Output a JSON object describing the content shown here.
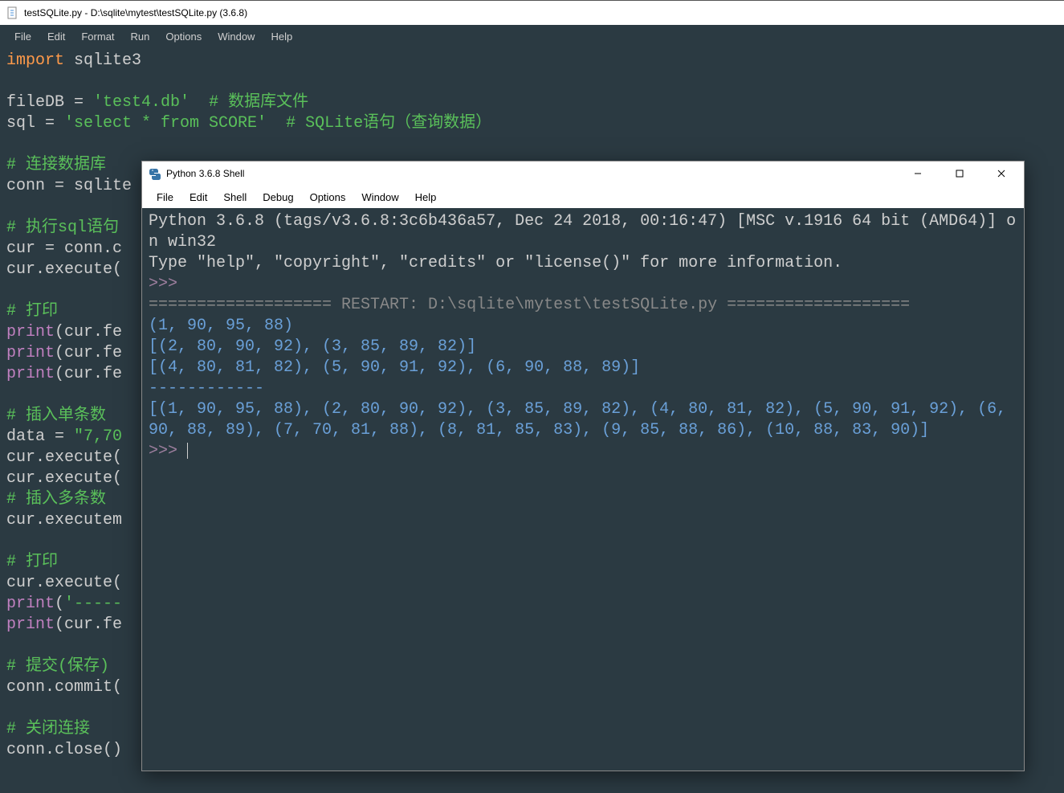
{
  "editor": {
    "title": "testSQLite.py - D:\\sqlite\\mytest\\testSQLite.py (3.6.8)",
    "menus": [
      "File",
      "Edit",
      "Format",
      "Run",
      "Options",
      "Window",
      "Help"
    ],
    "code": {
      "l1_import": "import",
      "l1_mod": " sqlite3",
      "blank": "",
      "l3a": "fileDB = ",
      "l3b": "'test4.db'",
      "l3c": "  # 数据库文件",
      "l4a": "sql = ",
      "l4b": "'select * from SCORE'",
      "l4c": "  # SQLite语句（查询数据）",
      "l6": "# 连接数据库",
      "l7": "conn = sqlite",
      "l9": "# 执行sql语句",
      "l10": "cur = conn.c",
      "l11": "cur.execute(",
      "l13": "# 打印",
      "l14a": "print",
      "l14b": "(cur.fe",
      "l15a": "print",
      "l15b": "(cur.fe",
      "l16a": "print",
      "l16b": "(cur.fe",
      "l18": "# 插入单条数",
      "l19a": "data = ",
      "l19b": "\"7,70",
      "l20": "cur.execute(",
      "l21": "cur.execute(",
      "l22": "# 插入多条数",
      "l23": "cur.executem",
      "l25": "# 打印",
      "l26": "cur.execute(",
      "l27a": "print",
      "l27b": "(",
      "l27c": "'-----",
      "l28a": "print",
      "l28b": "(cur.fe",
      "l30": "# 提交(保存)",
      "l31": "conn.commit(",
      "l33": "# 关闭连接",
      "l34": "conn.close()"
    }
  },
  "shell": {
    "title": "Python 3.6.8 Shell",
    "menus": [
      "File",
      "Edit",
      "Shell",
      "Debug",
      "Options",
      "Window",
      "Help"
    ],
    "banner1": "Python 3.6.8 (tags/v3.6.8:3c6b436a57, Dec 24 2018, 00:16:47) [MSC v.1916 64 bit (AMD64)] on win32",
    "banner2": "Type \"help\", \"copyright\", \"credits\" or \"license()\" for more information.",
    "prompt": ">>> ",
    "restart": "=================== RESTART: D:\\sqlite\\mytest\\testSQLite.py ===================",
    "out1": "(1, 90, 95, 88)",
    "out2": "[(2, 80, 90, 92), (3, 85, 89, 82)]",
    "out3": "[(4, 80, 81, 82), (5, 90, 91, 92), (6, 90, 88, 89)]",
    "out4": "------------",
    "out5": "[(1, 90, 95, 88), (2, 80, 90, 92), (3, 85, 89, 82), (4, 80, 81, 82), (5, 90, 91, 92), (6, 90, 88, 89), (7, 70, 81, 88), (8, 81, 85, 83), (9, 85, 88, 86), (10, 88, 83, 90)]"
  }
}
